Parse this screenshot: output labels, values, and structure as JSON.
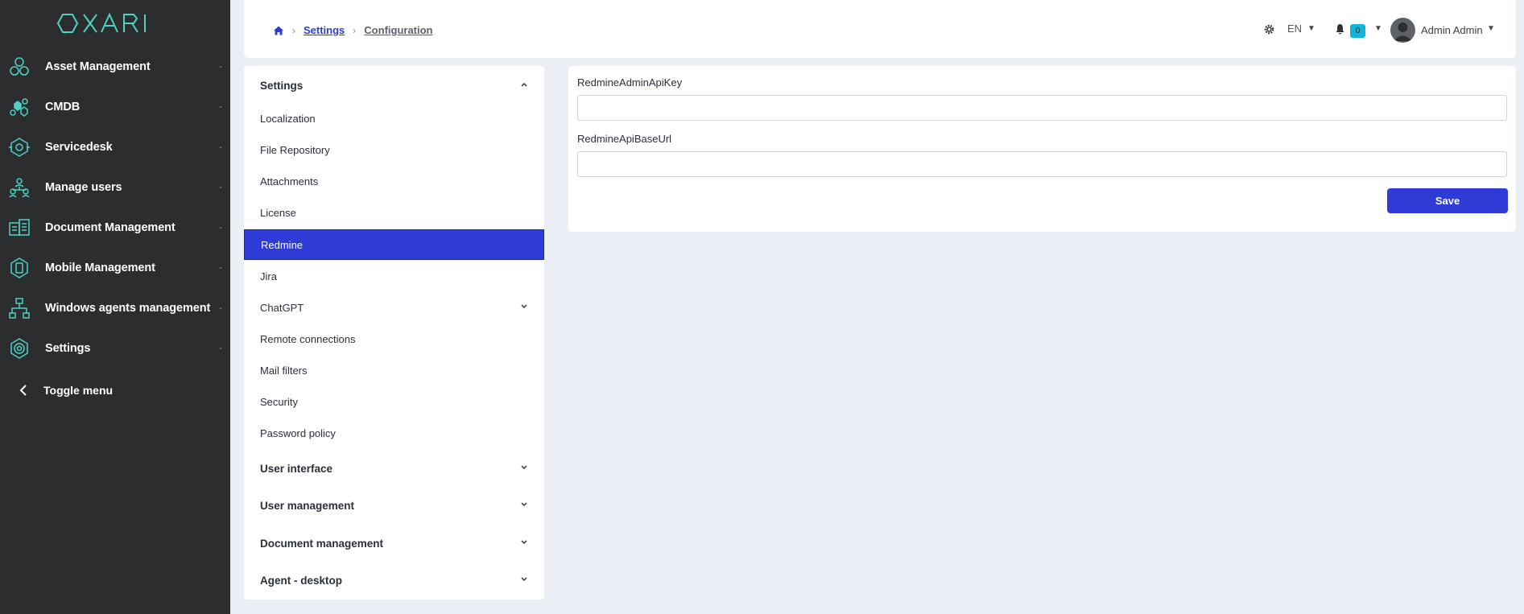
{
  "brand": {
    "logo_text": "OXARI",
    "accent": "#4fd1c5",
    "primary": "#2e3bd6"
  },
  "sidebar": {
    "items": [
      {
        "label": "Asset Management",
        "icon": "asset-hexagons-icon",
        "dash": "-"
      },
      {
        "label": "CMDB",
        "icon": "cmdb-icon",
        "dash": "-"
      },
      {
        "label": "Servicedesk",
        "icon": "servicedesk-eye-icon",
        "dash": "-"
      },
      {
        "label": "Manage users",
        "icon": "users-hierarchy-icon",
        "dash": "-"
      },
      {
        "label": "Document Management",
        "icon": "documents-icon",
        "dash": "-"
      },
      {
        "label": "Mobile Management",
        "icon": "mobile-icon",
        "dash": "-"
      },
      {
        "label": "Windows agents management",
        "icon": "network-icon",
        "dash": "-"
      },
      {
        "label": "Settings",
        "icon": "settings-cog-icon",
        "dash": "-"
      }
    ],
    "toggle_label": "Toggle menu"
  },
  "header": {
    "breadcrumb": {
      "settings": "Settings",
      "current": "Configuration"
    },
    "language": "EN",
    "notifications_count": "0",
    "user_name": "Admin Admin"
  },
  "settings_menu": {
    "title": "Settings",
    "items": [
      "Localization",
      "File Repository",
      "Attachments",
      "License",
      "Redmine",
      "Jira",
      "ChatGPT",
      "Remote connections",
      "Mail filters",
      "Security",
      "Password policy"
    ],
    "groups": [
      "User interface",
      "User management",
      "Document management",
      "Agent - desktop"
    ]
  },
  "form": {
    "field1_label": "RedmineAdminApiKey",
    "field1_value": "",
    "field2_label": "RedmineApiBaseUrl",
    "field2_value": "",
    "save_label": "Save"
  }
}
